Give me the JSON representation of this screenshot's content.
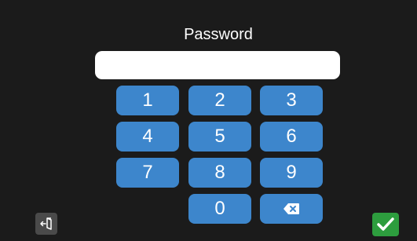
{
  "title": "Password",
  "password_field": {
    "value": "",
    "placeholder": ""
  },
  "keypad": {
    "keys": [
      "1",
      "2",
      "3",
      "4",
      "5",
      "6",
      "7",
      "8",
      "9",
      "0"
    ],
    "backspace_icon": "backspace-icon"
  },
  "footer": {
    "exit_icon": "exit-door-icon",
    "confirm_icon": "checkmark-icon"
  },
  "colors": {
    "background": "#1b1b1b",
    "key": "#3d86cc",
    "confirm": "#2d9d3e",
    "exit": "#4a4a4a"
  }
}
